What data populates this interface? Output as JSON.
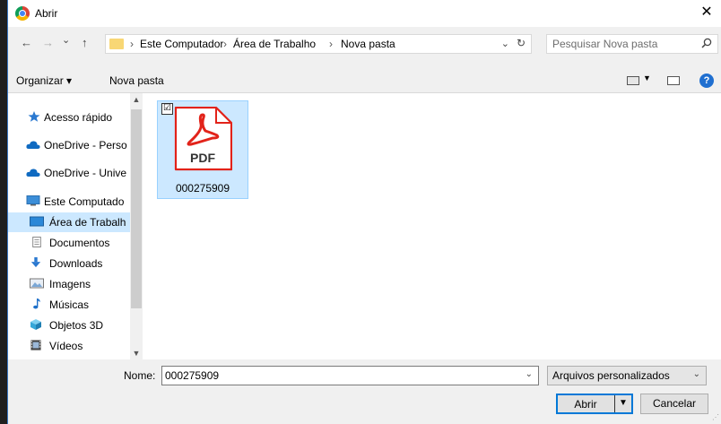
{
  "window": {
    "title": "Abrir",
    "close_glyph": "✕"
  },
  "nav": {
    "back": "←",
    "forward": "→",
    "recent": "⌄",
    "up": "↑"
  },
  "address": {
    "crumbs": [
      "Este Computador",
      "Área de Trabalho",
      "Nova pasta"
    ],
    "separator": "›",
    "dropdown": "⌄",
    "refresh": "↻"
  },
  "search": {
    "placeholder": "Pesquisar Nova pasta",
    "icon": "search-icon"
  },
  "toolbar": {
    "organize": "Organizar ▾",
    "new_folder": "Nova pasta",
    "help": "?"
  },
  "sidebar": {
    "items": [
      {
        "label": "Acesso rápido",
        "icon": "star-icon",
        "color": "#2b79d0"
      },
      {
        "label": "OneDrive - Perso",
        "icon": "cloud-icon",
        "color": "#0f6ac1"
      },
      {
        "label": "OneDrive - Unive",
        "icon": "cloud-icon",
        "color": "#0f6ac1"
      },
      {
        "label": "Este Computado",
        "icon": "computer-icon",
        "color": "#3c8ed8"
      },
      {
        "label": "Área de Trabalh",
        "icon": "desktop-icon",
        "color": "#2b88d8",
        "selected": true
      },
      {
        "label": "Documentos",
        "icon": "document-icon",
        "color": "#8a8a8a"
      },
      {
        "label": "Downloads",
        "icon": "download-icon",
        "color": "#2b79d0"
      },
      {
        "label": "Imagens",
        "icon": "image-icon",
        "color": "#7aa7d6"
      },
      {
        "label": "Músicas",
        "icon": "music-icon",
        "color": "#1d6fc9"
      },
      {
        "label": "Objetos 3D",
        "icon": "cube-icon",
        "color": "#35a7d8"
      },
      {
        "label": "Vídeos",
        "icon": "video-icon",
        "color": "#444444"
      }
    ]
  },
  "files": [
    {
      "name": "000275909",
      "type_badge": "PDF",
      "selected": true,
      "checked": "☑"
    }
  ],
  "bottom": {
    "name_label": "Nome:",
    "name_value": "000275909",
    "file_type": "Arquivos personalizados",
    "open_label": "Abrir",
    "cancel_label": "Cancelar"
  },
  "colors": {
    "accent": "#0078d7",
    "selection": "#cce8ff",
    "pdf_red": "#e2231a"
  }
}
